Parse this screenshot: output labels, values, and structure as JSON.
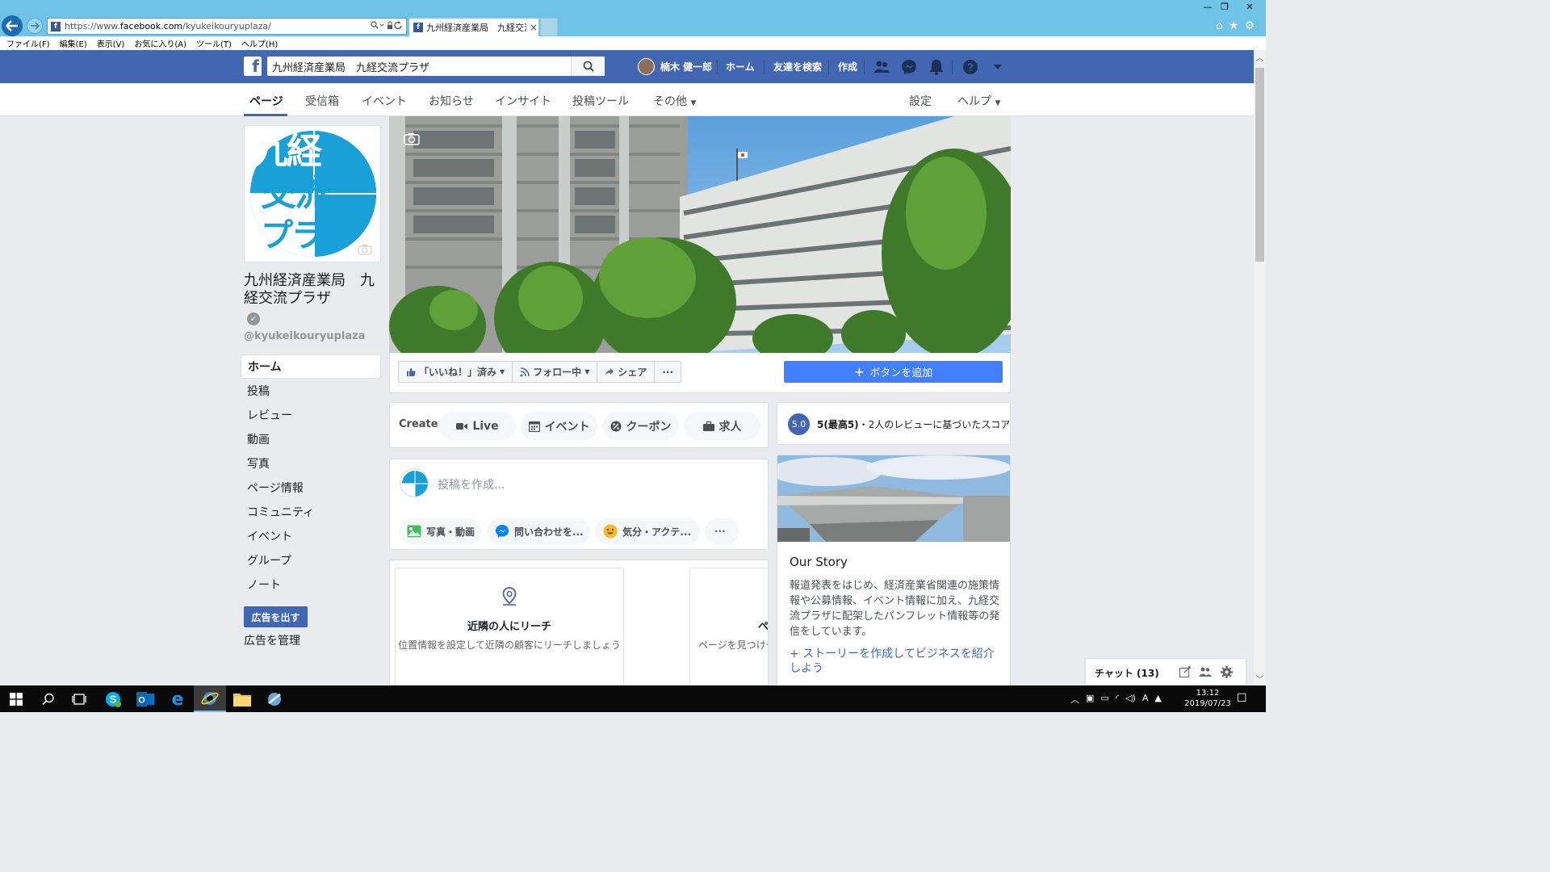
{
  "browser": {
    "url_scheme": "https://www.",
    "url_host": "facebook.com",
    "url_path": "/kyukeikouryuplaza/",
    "tab_title": "九州経済産業局　九経交流...",
    "tab_close": "×",
    "menu": [
      "ファイル(F)",
      "編集(E)",
      "表示(V)",
      "お気に入り(A)",
      "ツール(T)",
      "ヘルプ(H)"
    ],
    "window_min": "—",
    "window_max": "❐",
    "window_close": "✕"
  },
  "fb_header": {
    "search_value": "九州経済産業局　九経交流プラザ",
    "user_name": "楠木 健一郎",
    "home": "ホーム",
    "find_friends": "友達を検索",
    "create": "作成"
  },
  "page_tabs": [
    "ページ",
    "受信箱",
    "イベント",
    "お知らせ",
    "インサイト",
    "投稿ツール",
    "その他",
    "設定",
    "ヘルプ"
  ],
  "page": {
    "name": "九州経済産業局　九経交流プラザ",
    "handle": "@kyukeikouryuplaza",
    "logo_lines": [
      "九経",
      "交流",
      "プラザ"
    ]
  },
  "left_nav": [
    "ホーム",
    "投稿",
    "レビュー",
    "動画",
    "写真",
    "ページ情報",
    "コミュニティ",
    "イベント",
    "グループ",
    "ノート"
  ],
  "ads": {
    "promote_button": "広告を出す",
    "manage_link": "広告を管理"
  },
  "actions": {
    "liked": "「いいね！」済み",
    "following": "フォロー中",
    "share": "シェア",
    "more": "···",
    "add_button": "ボタンを追加"
  },
  "create_bar": {
    "label": "Create",
    "live": "Live",
    "event": "イベント",
    "coupon": "クーポン",
    "job": "求人"
  },
  "composer": {
    "placeholder": "投稿を作成...",
    "photo_video": "写真・動画",
    "ask": "問い合わせを...",
    "feeling": "気分・アクテ...",
    "more": "···"
  },
  "promo": {
    "title": "近隣の人にリーチ",
    "description": "位置情報を設定して近隣の顧客にリーチしましょう",
    "title2": "ペ",
    "description2": "ページを見つけや"
  },
  "rating": {
    "score": "5.0",
    "max_label": "5(最高5)",
    "description": "・2人のレビューに基づいたスコア"
  },
  "story": {
    "title": "Our Story",
    "body": "報道発表をはじめ、経済産業省関連の施策情報や公募情報、イベント情報に加え、九経交流プラザに配架したパンフレット情報等の発信をしています。",
    "link": "+ ストーリーを作成してビジネスを紹介しよう"
  },
  "chat": {
    "label": "チャット (13)"
  },
  "taskbar": {
    "time": "13:12",
    "date": "2019/07/23"
  },
  "colors": {
    "fb_blue": "#4267b2",
    "ie_blue": "#6ec3e6",
    "cta_blue": "#4080ff",
    "logo_blue": "#1aa0d8"
  }
}
